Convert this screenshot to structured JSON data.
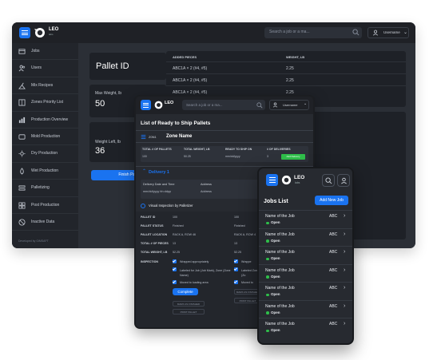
{
  "brand": {
    "name": "LEO",
    "sub": "labs"
  },
  "colors": {
    "accent": "#1a73f0",
    "status_open": "#2fbf4a",
    "deliveries_badge": "#2fbf4a"
  },
  "desktop": {
    "search_placeholder": "Search a job or a ma...",
    "user": "Username",
    "sidebar": [
      {
        "label": "Jobs",
        "icon": "box-icon"
      },
      {
        "label": "Users",
        "icon": "users-icon"
      },
      {
        "label": "Mix Recipes",
        "icon": "mix-icon"
      },
      {
        "label": "Zones Priority List",
        "icon": "zones-icon"
      },
      {
        "label": "Production Overview",
        "icon": "overview-icon"
      },
      {
        "label": "Mold Production",
        "icon": "mold-icon"
      },
      {
        "label": "Dry Production",
        "icon": "dry-icon"
      },
      {
        "label": "Wet Production",
        "icon": "wet-icon"
      },
      {
        "label": "Palletizing",
        "icon": "pallet-icon"
      },
      {
        "label": "Post Production",
        "icon": "post-icon"
      },
      {
        "label": "Inactive Data",
        "icon": "inactive-icon"
      }
    ],
    "powered_by": "Developed by GiMSAFT",
    "pallet": {
      "title": "Pallet ID",
      "max_weight_label": "Max Weight, lb",
      "max_weight_value": "50",
      "weight_left_label": "Weight Left, lb",
      "weight_left_value": "36",
      "finish_button": "Finish Pallet"
    },
    "pieces": {
      "headers": [
        "ADDED PIECES",
        "WEIGHT, LB"
      ],
      "rows": [
        [
          "ABC1A × 2 (#4, #5)",
          "2.25"
        ],
        [
          "ABC1A × 2 (#4, #5)",
          "2.25"
        ],
        [
          "ABC1A × 2 (#4, #5)",
          "2.25"
        ]
      ]
    }
  },
  "tablet": {
    "search_placeholder": "Search a job or a ma...",
    "user": "Username",
    "title": "List of Ready to Ship Pallets",
    "zone_code": "Z0N1",
    "zone_name": "Zone Name",
    "summary_headers": [
      "TOTAL # OF PALLETS",
      "TOTAL WEIGHT, LB",
      "READY TO SHIP ON",
      "# OF DELIVERIES"
    ],
    "summary_values": [
      "100",
      "50.25",
      "mm/dd/yyyy",
      "3"
    ],
    "deliveries_badge": "Add Delivery",
    "delivery_title": "Delivery 1",
    "delivery_date_label": "Delivery Date and Time",
    "delivery_date_value": "mm/dd/yyyy hh:ddpp",
    "address_label": "Address",
    "address_value": "Address",
    "visual_inspection": "Visual Inspection by Palletizer",
    "rows": [
      {
        "k": "PALLET ID",
        "v1": "100",
        "v2": "100"
      },
      {
        "k": "PALLET STATUS",
        "v1": "Finished",
        "v2": "Finished"
      },
      {
        "k": "PALLET LOCATION",
        "v1": "RACK A, ROW 46",
        "v2": "RACK A, ROW 4"
      },
      {
        "k": "TOTAL # OF PIECES",
        "v1": "13",
        "v2": "13"
      },
      {
        "k": "TOTAL WEIGHT, LB",
        "v1": "52.25",
        "v2": "52.25"
      }
    ],
    "inspection_label": "INSPECTION",
    "inspection_items": [
      "Wrapped appropriately",
      "Labeled for Job (Job Mark), Zone (Zone Name)",
      "Moved to loading area"
    ],
    "inspection_items_col2": [
      "Wrappe",
      "Labeled Zone (Zo",
      "Moved to"
    ],
    "complete_button": "Complete",
    "small_button_1": "MARK AS FINISHED",
    "small_button_2": "PRINT PALLET",
    "small_button_3": "MARK AS FINISHED",
    "small_button_4": "PRINT PALLET"
  },
  "phone": {
    "title": "Jobs List",
    "add_button": "Add New Job",
    "jobs": [
      {
        "name": "Name of the Job",
        "code": "ABC",
        "status": "Open"
      },
      {
        "name": "Name of the Job",
        "code": "ABC",
        "status": "Open"
      },
      {
        "name": "Name of the Job",
        "code": "ABC",
        "status": "Open"
      },
      {
        "name": "Name of the Job",
        "code": "ABC",
        "status": "Open"
      },
      {
        "name": "Name of the Job",
        "code": "ABC",
        "status": "Open"
      },
      {
        "name": "Name of the Job",
        "code": "ABC",
        "status": "Open"
      },
      {
        "name": "Name of the Job",
        "code": "ABC",
        "status": "Open"
      }
    ]
  }
}
